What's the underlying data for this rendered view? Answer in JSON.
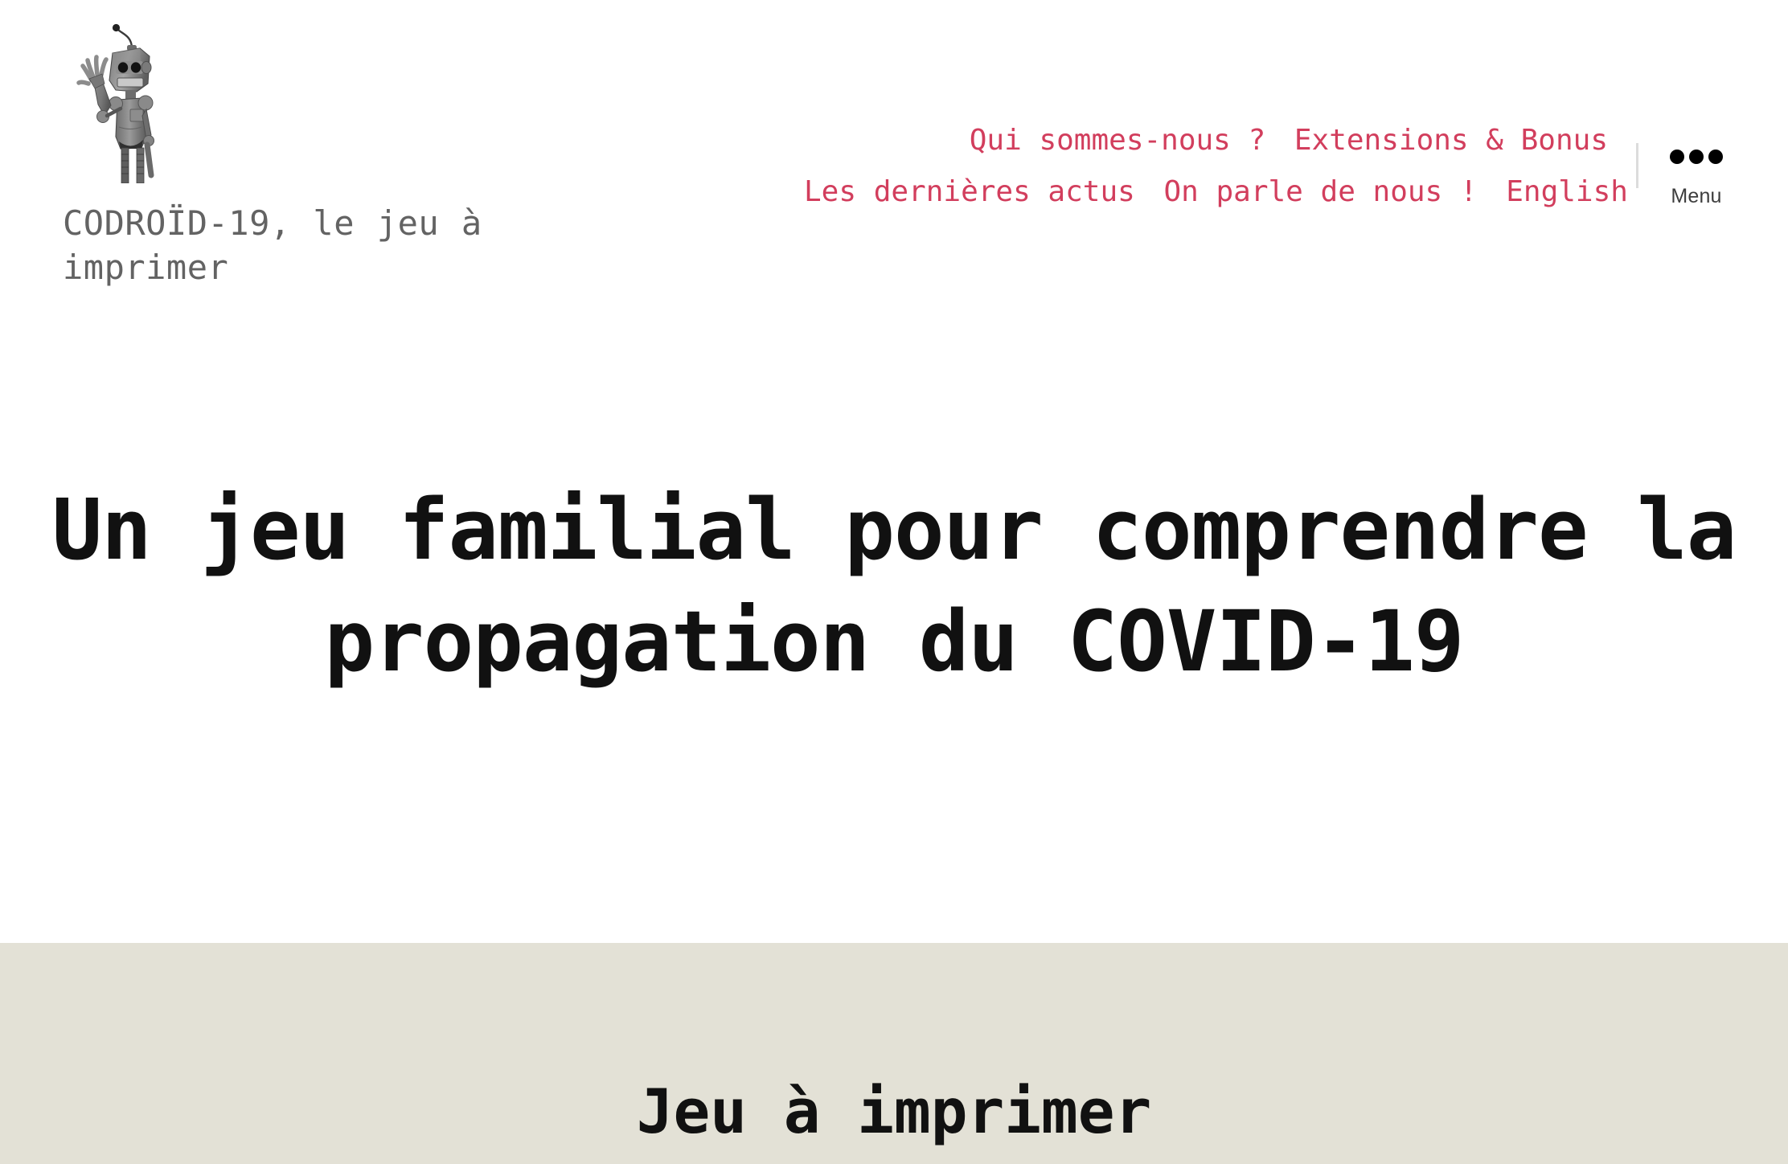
{
  "colors": {
    "background": "#ffffff",
    "nav_link": "#d23e5d",
    "site_title": "#636363",
    "heading": "#111111",
    "section_background": "#e3e1d6",
    "menu_label": "#3d3d3d",
    "divider": "#dcdcdc"
  },
  "header": {
    "logo": {
      "icon": "waving-robot-logo",
      "alt": "CODROID-19 robot logo"
    },
    "site_title": "CODROÏD-19, le jeu à imprimer",
    "nav": {
      "rows": [
        [
          {
            "label": "Qui sommes-nous ?"
          },
          {
            "label": "Extensions & Bonus"
          }
        ],
        [
          {
            "label": "Les dernières actus"
          },
          {
            "label": "On parle de nous !"
          },
          {
            "label": "English"
          }
        ]
      ]
    },
    "menu_toggle": {
      "icon": "three-dots-icon",
      "label": "Menu"
    }
  },
  "hero": {
    "title": "Un jeu familial pour comprendre la propagation du COVID-19"
  },
  "beige_section": {
    "heading": "Jeu à imprimer"
  }
}
